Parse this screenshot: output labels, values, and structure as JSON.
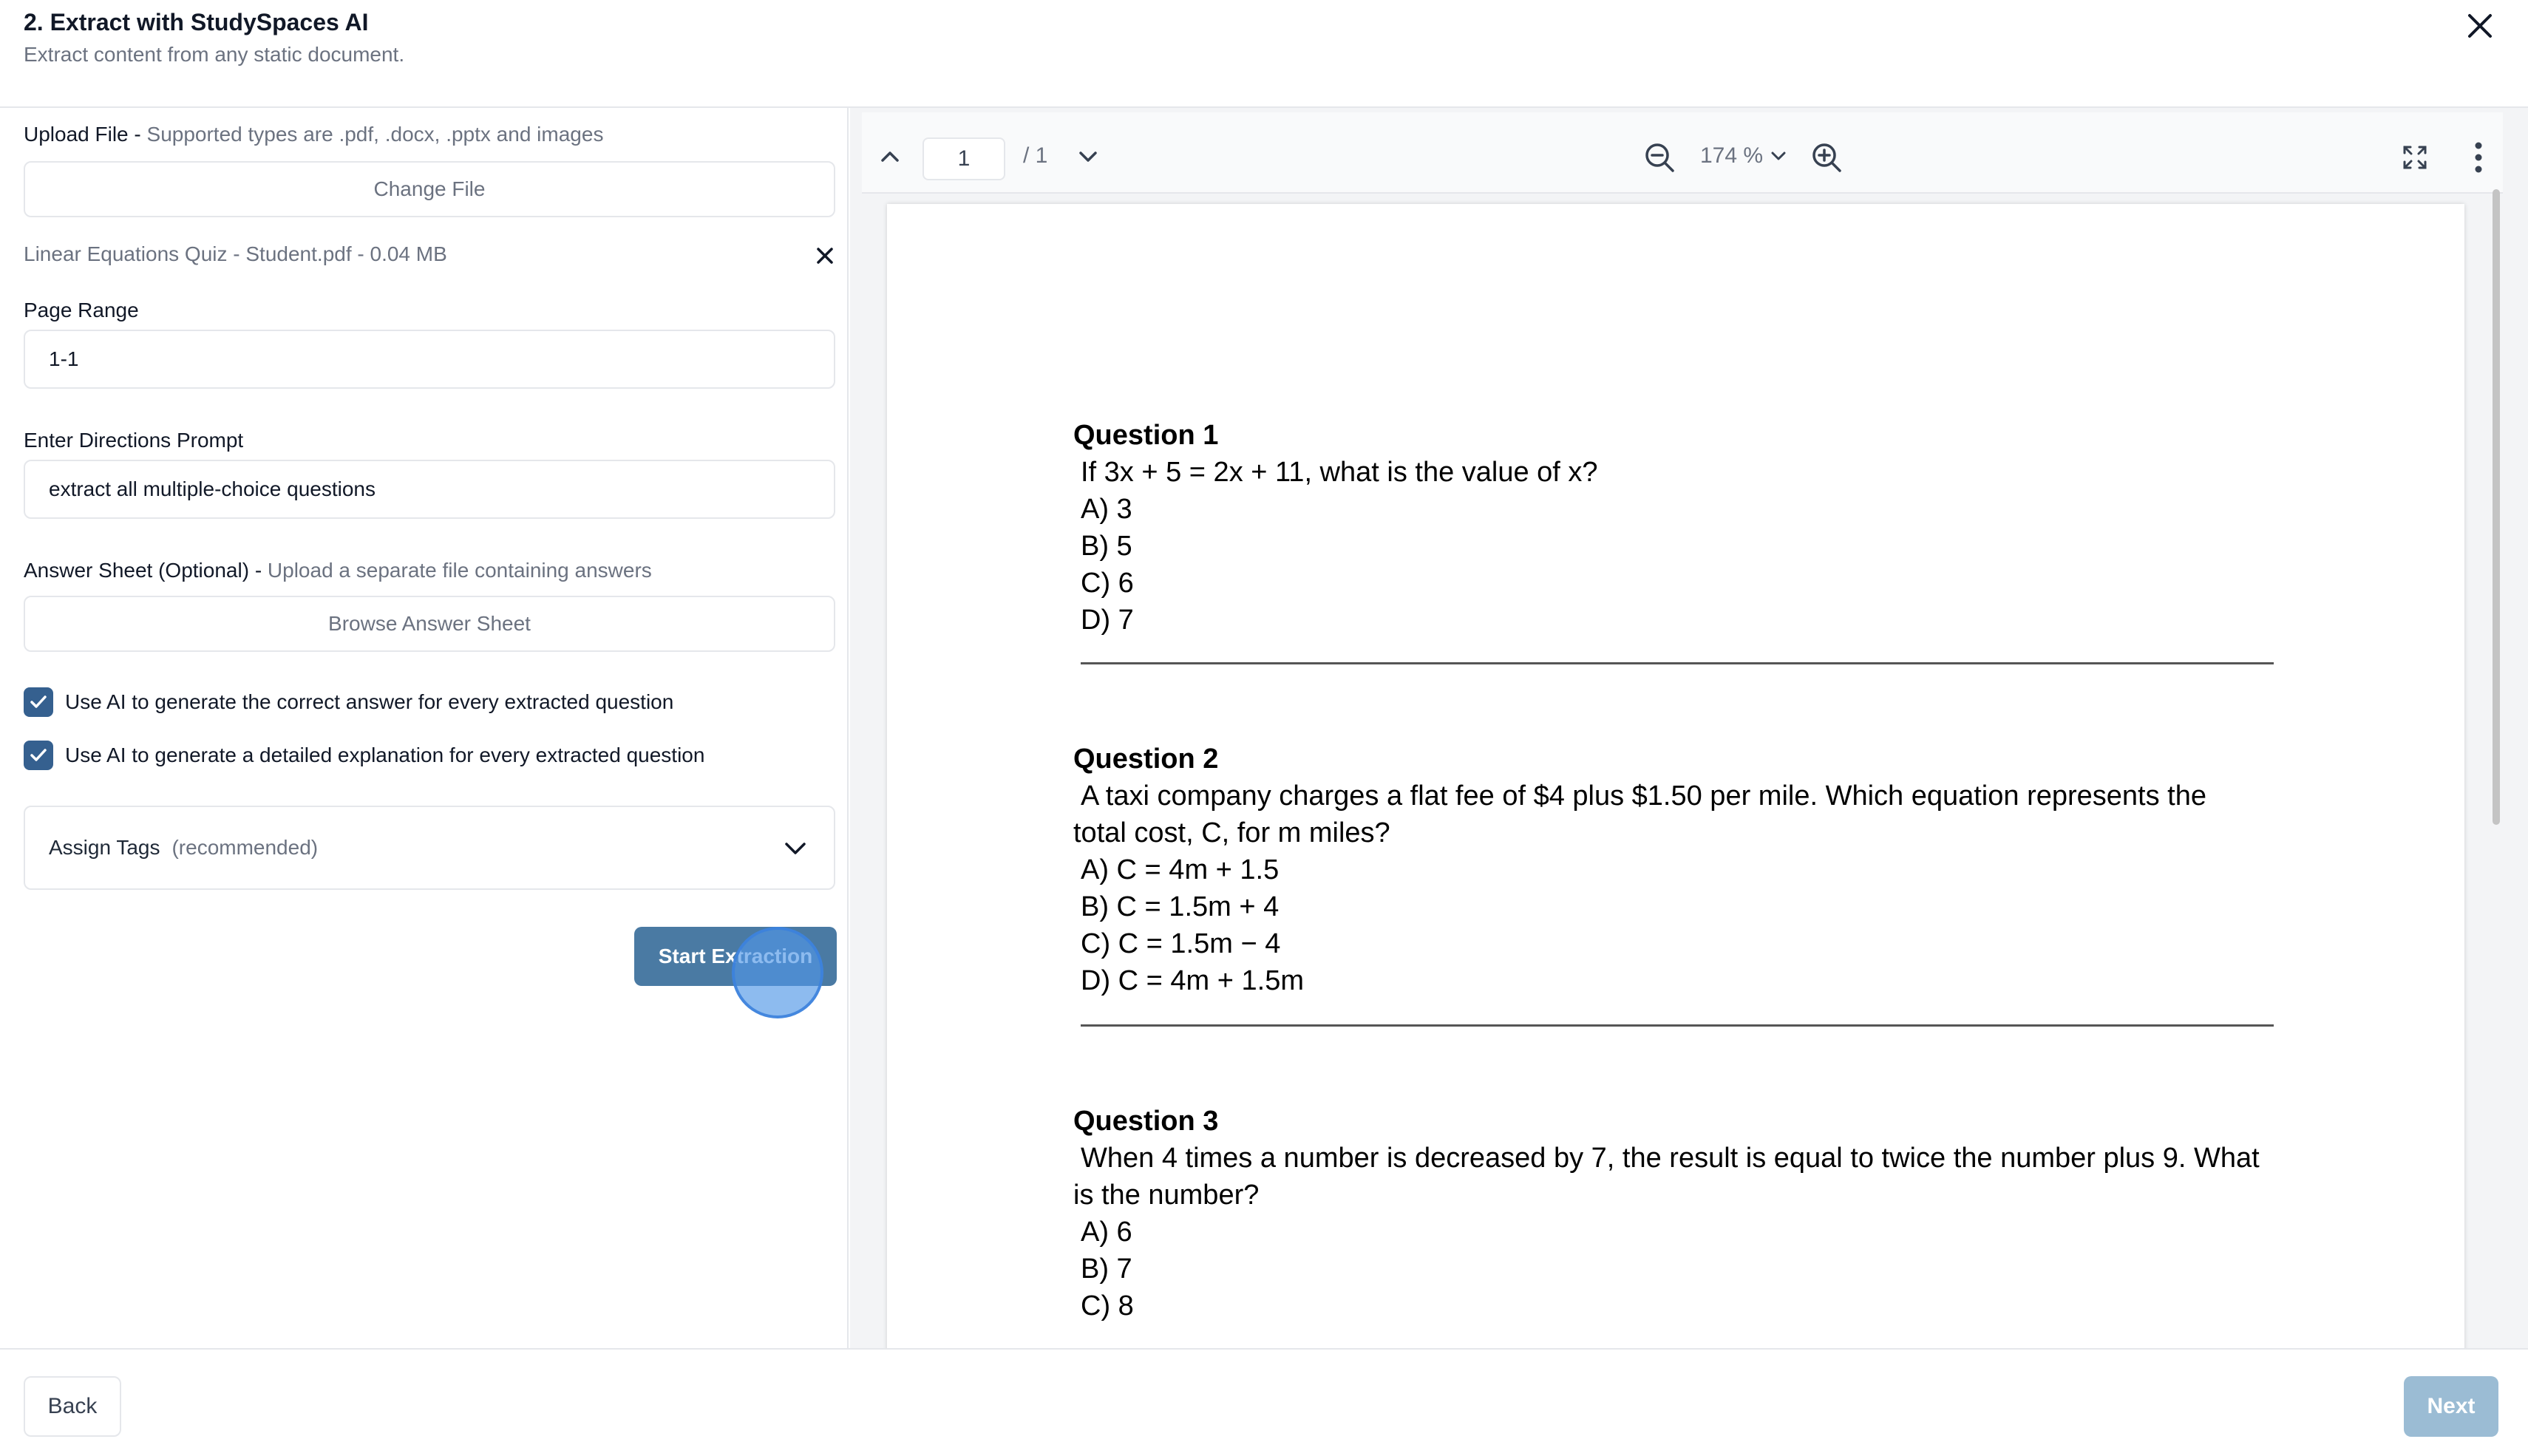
{
  "header": {
    "title": "2. Extract with StudySpaces AI",
    "subtitle": "Extract content from any static document."
  },
  "form": {
    "upload_label": "Upload File - ",
    "upload_hint": "Supported types are .pdf, .docx, .pptx and images",
    "change_file_label": "Change File",
    "file_info": "Linear Equations Quiz - Student.pdf - 0.04 MB",
    "page_range_label": "Page Range",
    "page_range_value": "1-1",
    "directions_label": "Enter Directions Prompt",
    "directions_value": "extract all multiple-choice questions",
    "answer_sheet_label": "Answer Sheet (Optional) - ",
    "answer_sheet_hint": "Upload a separate file containing answers",
    "browse_answer_label": "Browse Answer Sheet",
    "checkboxes": [
      {
        "label": "Use AI to generate the correct answer for every extracted question",
        "checked": true
      },
      {
        "label": "Use AI to generate a detailed explanation for every extracted question",
        "checked": true
      }
    ],
    "tags_label": "Assign Tags",
    "tags_hint": "(recommended)",
    "start_label": "Start Extraction"
  },
  "viewer": {
    "page_current": "1",
    "page_total": "/ 1",
    "zoom": "174 %",
    "questions": [
      {
        "title": "Question 1",
        "lines": [
          "If 3x + 5 = 2x + 11, what is the value of x?",
          "A) 3",
          "B) 5",
          "C) 6",
          "D) 7"
        ]
      },
      {
        "title": "Question 2",
        "lines": [
          "A taxi company charges a flat fee of $4 plus $1.50 per mile. Which equation represents the",
          "total cost, C, for m miles?",
          "A) C = 4m + 1.5",
          "B) C = 1.5m + 4",
          "C) C = 1.5m − 4",
          "D) C = 4m + 1.5m"
        ]
      },
      {
        "title": "Question 3",
        "lines": [
          "When 4 times a number is decreased by 7, the result is equal to twice the number plus 9. What",
          "is the number?",
          "A) 6",
          "B) 7",
          "C) 8"
        ]
      }
    ]
  },
  "footer": {
    "back_label": "Back",
    "next_label": "Next"
  },
  "colors": {
    "accent": "#35608f",
    "start_button": "#4a7aa3",
    "next_disabled": "#9bbcd4"
  }
}
